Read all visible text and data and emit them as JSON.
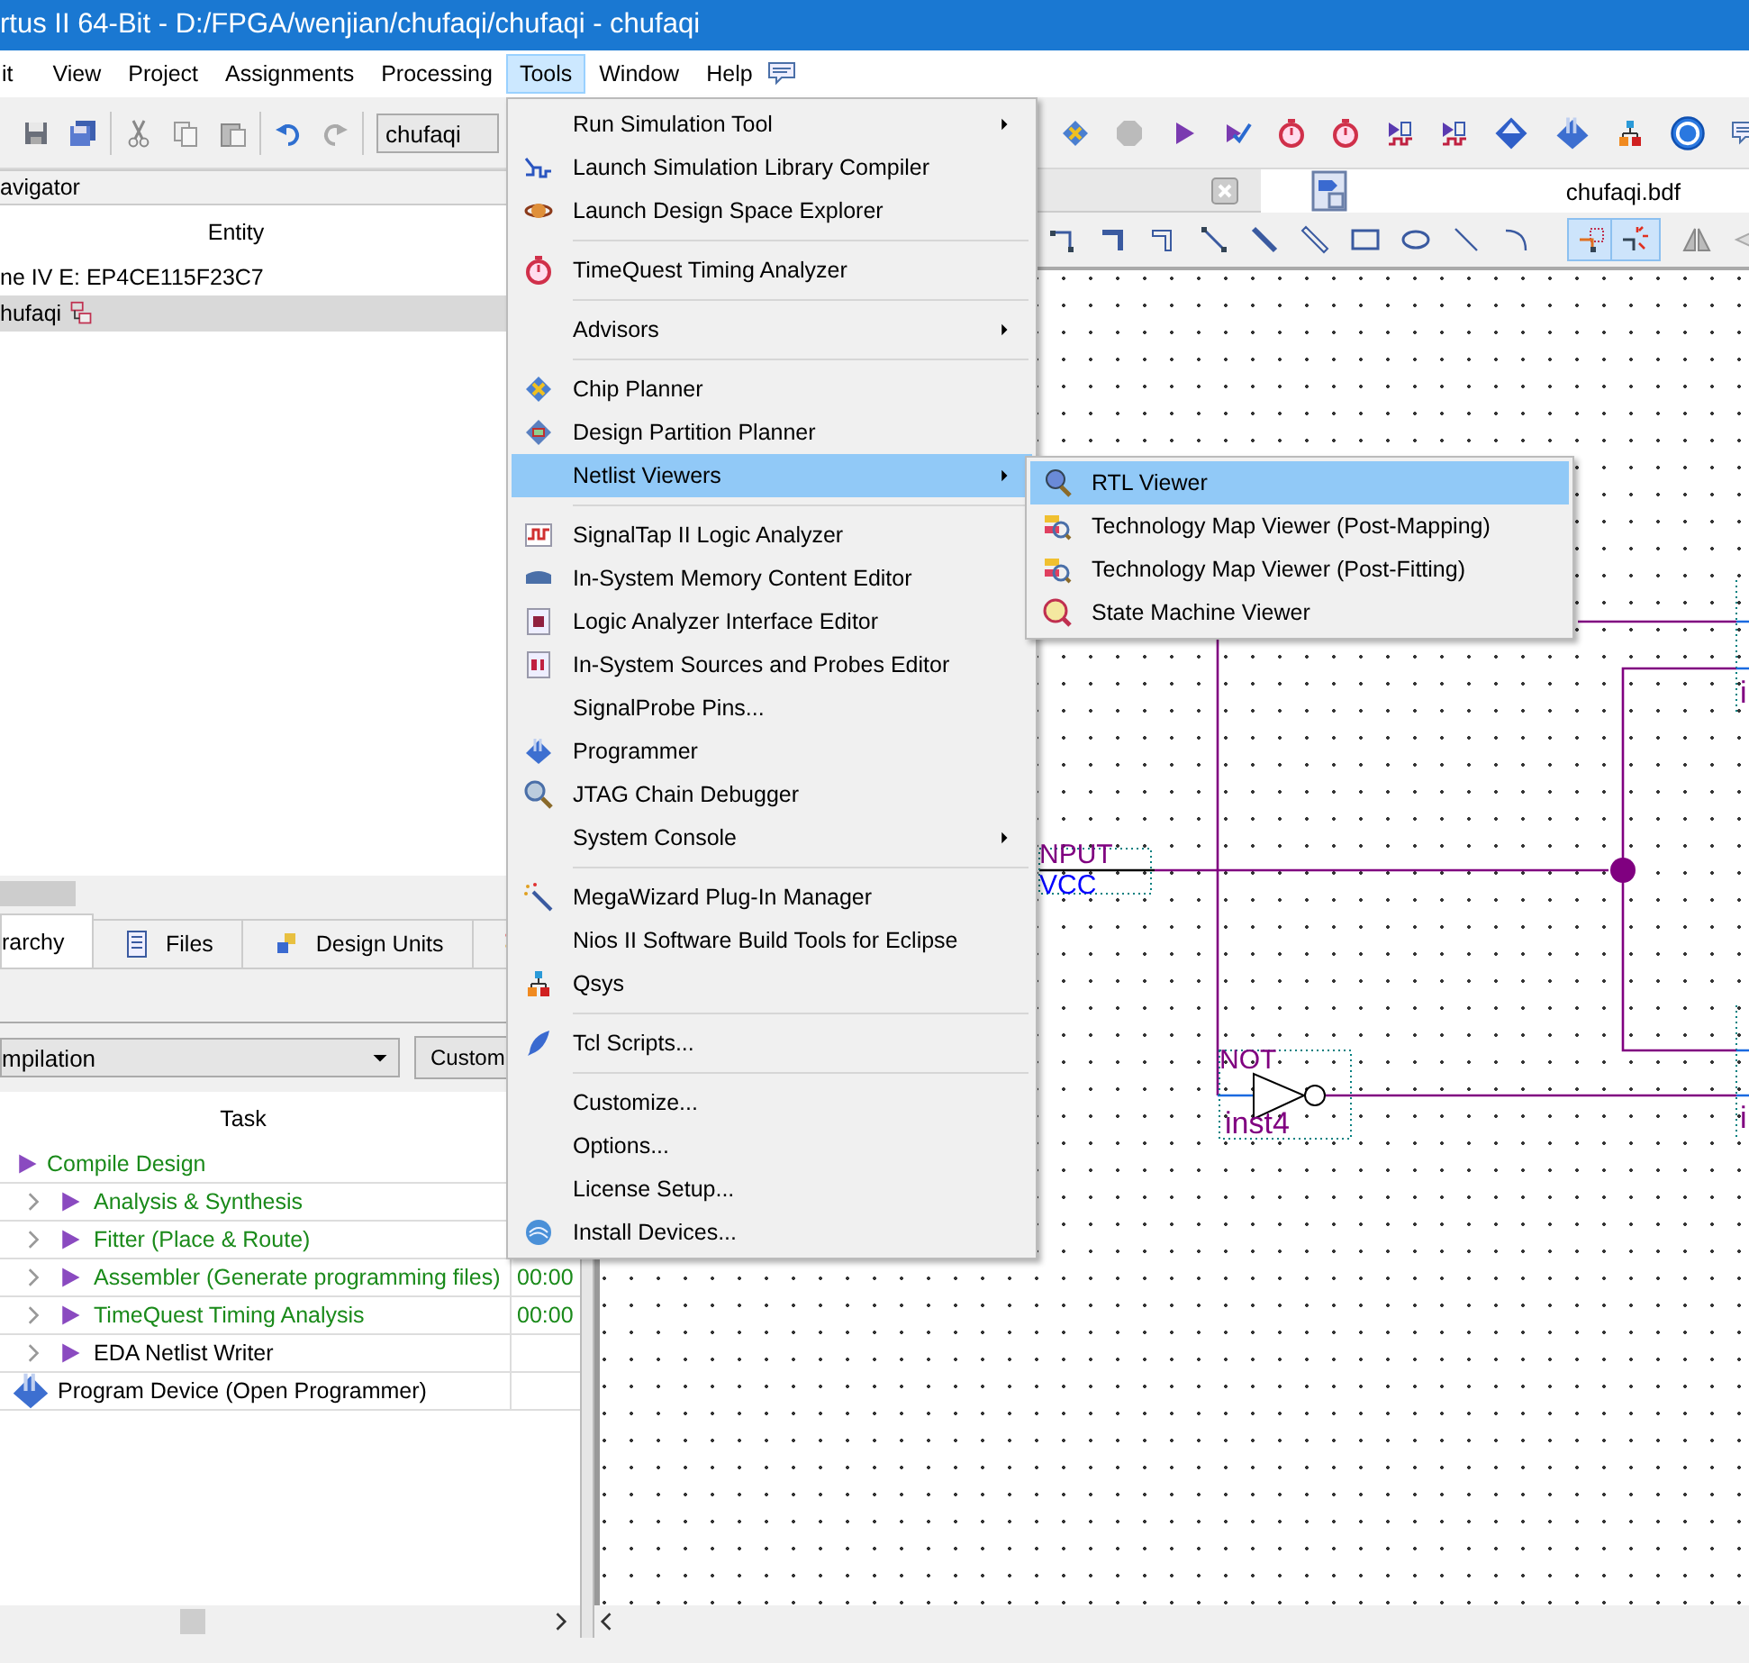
{
  "window": {
    "title": "rtus II 64-Bit - D:/FPGA/wenjian/chufaqi/chufaqi - chufaqi"
  },
  "menubar": [
    {
      "label": "it",
      "selected": false
    },
    {
      "label": "View",
      "selected": false
    },
    {
      "label": "Project",
      "selected": false
    },
    {
      "label": "Assignments",
      "selected": false
    },
    {
      "label": "Processing",
      "selected": false
    },
    {
      "label": "Tools",
      "selected": true
    },
    {
      "label": "Window",
      "selected": false
    },
    {
      "label": "Help",
      "selected": false
    }
  ],
  "toolbar": {
    "project_combo": "chufaqi"
  },
  "navigator": {
    "title": "avigator",
    "column": "Entity",
    "rows": [
      {
        "label": "ne IV E: EP4CE115F23C7",
        "selected": false
      },
      {
        "label": "hufaqi",
        "selected": true
      }
    ]
  },
  "nav_tabs": [
    {
      "label": "rarchy",
      "selected": true
    },
    {
      "label": "Files",
      "selected": false
    },
    {
      "label": "Design Units",
      "selected": false
    }
  ],
  "tasks": {
    "flow": "mpilation",
    "button": "Custom",
    "column": "Task",
    "rows": [
      {
        "kind": "flow",
        "label": "Compile Design",
        "color": "#1a8a1a",
        "children": [
          {
            "label": "Analysis & Synthesis",
            "color": "#1a8a1a",
            "expanded": false
          },
          {
            "label": "Fitter (Place & Route)",
            "color": "#1a8a1a",
            "expanded": false
          },
          {
            "label": "Assembler (Generate programming files)",
            "color": "#1a8a1a",
            "expanded": false,
            "time": "00:00"
          },
          {
            "label": "TimeQuest Timing Analysis",
            "color": "#1a8a1a",
            "expanded": false,
            "time": "00:00"
          },
          {
            "label": "EDA Netlist Writer",
            "color": "#000000",
            "expanded": false
          }
        ]
      },
      {
        "kind": "program",
        "label": "Program Device (Open Programmer)",
        "color": "#000000"
      }
    ]
  },
  "editor_tabs": [
    {
      "label": "chufaqi.bdf",
      "selected": true
    }
  ],
  "tools_menu": [
    {
      "kind": "item",
      "label": "Run Simulation Tool",
      "submenu": true,
      "selected": false
    },
    {
      "kind": "item",
      "label": "Launch Simulation Library Compiler",
      "submenu": false,
      "selected": false
    },
    {
      "kind": "item",
      "label": "Launch Design Space Explorer",
      "submenu": false,
      "selected": false
    },
    {
      "kind": "separator"
    },
    {
      "kind": "item",
      "label": "TimeQuest Timing Analyzer",
      "submenu": false,
      "selected": false
    },
    {
      "kind": "separator"
    },
    {
      "kind": "item",
      "label": "Advisors",
      "submenu": true,
      "selected": false
    },
    {
      "kind": "separator"
    },
    {
      "kind": "item",
      "label": "Chip Planner",
      "submenu": false,
      "selected": false
    },
    {
      "kind": "item",
      "label": "Design Partition Planner",
      "submenu": false,
      "selected": false
    },
    {
      "kind": "item",
      "label": "Netlist Viewers",
      "submenu": true,
      "selected": true
    },
    {
      "kind": "separator"
    },
    {
      "kind": "item",
      "label": "SignalTap II Logic Analyzer",
      "submenu": false,
      "selected": false
    },
    {
      "kind": "item",
      "label": "In-System Memory Content Editor",
      "submenu": false,
      "selected": false
    },
    {
      "kind": "item",
      "label": "Logic Analyzer Interface Editor",
      "submenu": false,
      "selected": false
    },
    {
      "kind": "item",
      "label": "In-System Sources and Probes Editor",
      "submenu": false,
      "selected": false
    },
    {
      "kind": "item",
      "label": "SignalProbe Pins...",
      "submenu": false,
      "selected": false
    },
    {
      "kind": "item",
      "label": "Programmer",
      "submenu": false,
      "selected": false
    },
    {
      "kind": "item",
      "label": "JTAG Chain Debugger",
      "submenu": false,
      "selected": false
    },
    {
      "kind": "item",
      "label": "System Console",
      "submenu": true,
      "selected": false
    },
    {
      "kind": "separator"
    },
    {
      "kind": "item",
      "label": "MegaWizard Plug-In Manager",
      "submenu": false,
      "selected": false
    },
    {
      "kind": "item",
      "label": "Nios II Software Build Tools for Eclipse",
      "submenu": false,
      "selected": false
    },
    {
      "kind": "item",
      "label": "Qsys",
      "submenu": false,
      "selected": false
    },
    {
      "kind": "separator"
    },
    {
      "kind": "item",
      "label": "Tcl Scripts...",
      "submenu": false,
      "selected": false
    },
    {
      "kind": "separator"
    },
    {
      "kind": "item",
      "label": "Customize...",
      "submenu": false,
      "selected": false
    },
    {
      "kind": "item",
      "label": "Options...",
      "submenu": false,
      "selected": false
    },
    {
      "kind": "item",
      "label": "License Setup...",
      "submenu": false,
      "selected": false
    },
    {
      "kind": "item",
      "label": "Install Devices...",
      "submenu": false,
      "selected": false
    }
  ],
  "netlist_submenu": [
    {
      "label": "RTL Viewer",
      "selected": true
    },
    {
      "label": "Technology Map Viewer (Post-Mapping)",
      "selected": false
    },
    {
      "label": "Technology Map Viewer (Post-Fitting)",
      "selected": false
    },
    {
      "label": "State Machine Viewer",
      "selected": false
    }
  ],
  "schematic": {
    "labels": [
      "NPUT",
      "VCC",
      "NOT",
      "inst4",
      "i",
      "i"
    ]
  }
}
